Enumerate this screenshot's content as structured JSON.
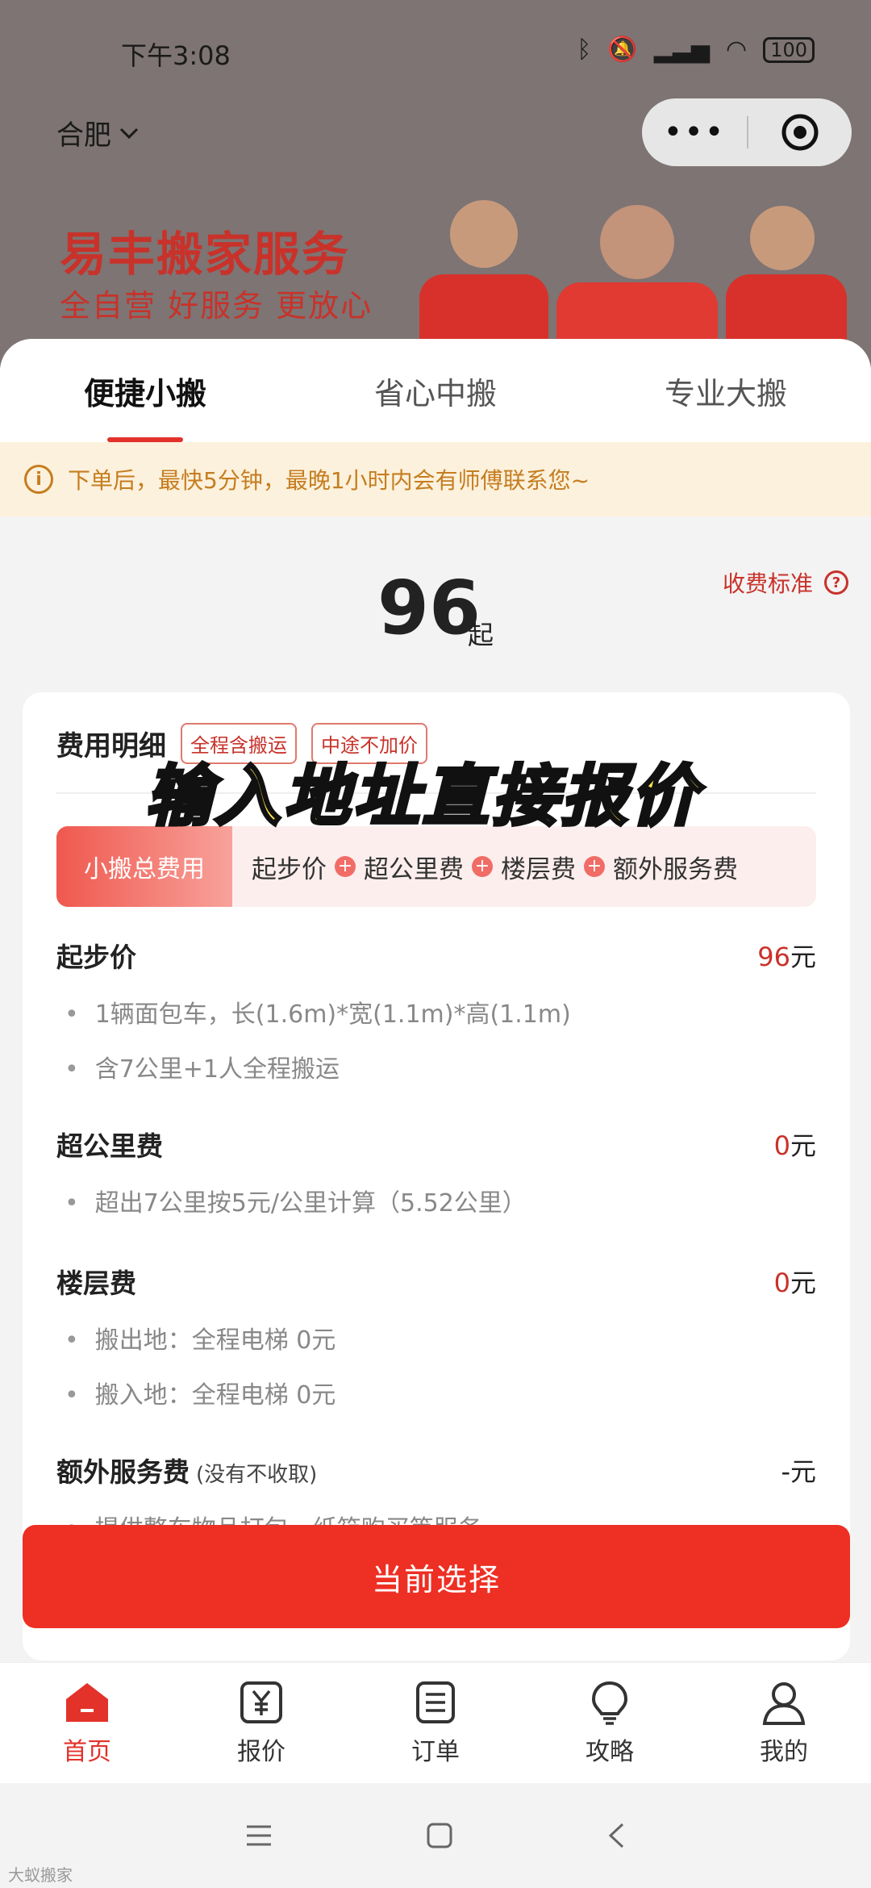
{
  "status": {
    "time": "下午3:08",
    "battery": "100"
  },
  "header": {
    "city": "合肥",
    "banner_title": "易丰搬家服务",
    "banner_subtitle": "全自营 好服务 更放心"
  },
  "tabs": [
    {
      "label": "便捷小搬",
      "active": true
    },
    {
      "label": "省心中搬",
      "active": false
    },
    {
      "label": "专业大搬",
      "active": false
    }
  ],
  "notice": {
    "text": "下单后，最快5分钟，最晚1小时内会有师傅联系您~"
  },
  "price": {
    "value": "96",
    "suffix": "起",
    "fee_standard": "收费标准"
  },
  "detail": {
    "title": "费用明细",
    "tags": [
      "全程含搬运",
      "中途不加价"
    ],
    "formula": {
      "label": "小搬总费用",
      "parts": [
        "起步价",
        "超公里费",
        "楼层费",
        "额外服务费"
      ]
    },
    "sections": [
      {
        "name": "起步价",
        "value_num": "96",
        "value_unit": "元",
        "items": [
          "1辆面包车，长(1.6m)*宽(1.1m)*高(1.1m)",
          "含7公里+1人全程搬运"
        ]
      },
      {
        "name": "超公里费",
        "value_num": "0",
        "value_unit": "元",
        "items": [
          "超出7公里按5元/公里计算（5.52公里）"
        ]
      },
      {
        "name": "楼层费",
        "value_num": "0",
        "value_unit": "元",
        "items": [
          "搬出地：全程电梯 0元",
          "搬入地：全程电梯 0元"
        ]
      },
      {
        "name": "额外服务费",
        "note": "(没有不收取)",
        "value_num": "-",
        "value_unit": "元",
        "items": [
          "提供整车物品打包、纸箱购买等服务"
        ]
      }
    ]
  },
  "overlay_caption": "输入地址直接报价",
  "cta": {
    "label": "当前选择"
  },
  "tabbar": [
    {
      "label": "首页",
      "icon": "home-icon",
      "active": true
    },
    {
      "label": "报价",
      "icon": "yen-icon",
      "active": false
    },
    {
      "label": "订单",
      "icon": "order-icon",
      "active": false
    },
    {
      "label": "攻略",
      "icon": "bulb-icon",
      "active": false
    },
    {
      "label": "我的",
      "icon": "user-icon",
      "active": false
    }
  ],
  "watermark": "大蚁搬家",
  "colors": {
    "accent": "#e2322a",
    "cta": "#ee2f24",
    "banner_bg": "#7d7473",
    "notice_bg": "#fcf1dc"
  }
}
